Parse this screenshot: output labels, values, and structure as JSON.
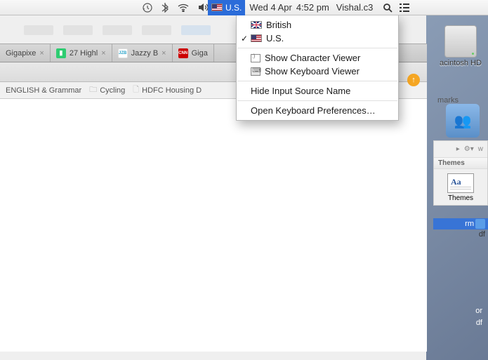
{
  "menubar": {
    "input_source_label": "U.S.",
    "date": "Wed 4 Apr",
    "time": "4:52 pm",
    "user": "Vishal.c3"
  },
  "dropdown": {
    "items": [
      {
        "label": "British",
        "type": "flag-uk",
        "checked": false
      },
      {
        "label": "U.S.",
        "type": "flag-us",
        "checked": true
      }
    ],
    "viewers": [
      {
        "label": "Show Character Viewer"
      },
      {
        "label": "Show Keyboard Viewer"
      }
    ],
    "hide": "Hide Input Source Name",
    "prefs": "Open Keyboard Preferences…"
  },
  "tabs": [
    {
      "label": "Gigapixe",
      "favicon": "",
      "fcolor": "#ccc"
    },
    {
      "label": "27 Highl",
      "favicon": "",
      "fcolor": "#2ecc71"
    },
    {
      "label": "Jazzy B",
      "favicon": "JZB",
      "fcolor": "#2aa3c9"
    },
    {
      "label": "Giga",
      "favicon": "CNN",
      "fcolor": "#cc0000"
    }
  ],
  "bookmarks": [
    {
      "label": "ENGLISH & Grammar",
      "icon": "folder"
    },
    {
      "label": "Cycling",
      "icon": "folder"
    },
    {
      "label": "HDFC Housing D",
      "icon": "page"
    }
  ],
  "other_bookmarks": "marks",
  "desktop": {
    "hd_label": "acintosh HD",
    "file_ext1": "rm",
    "file_ext2": "df",
    "file_ext3": "or",
    "file_ext4": "df"
  },
  "panel": {
    "header": "Themes",
    "main_label": "Themes",
    "w_label": "w"
  }
}
